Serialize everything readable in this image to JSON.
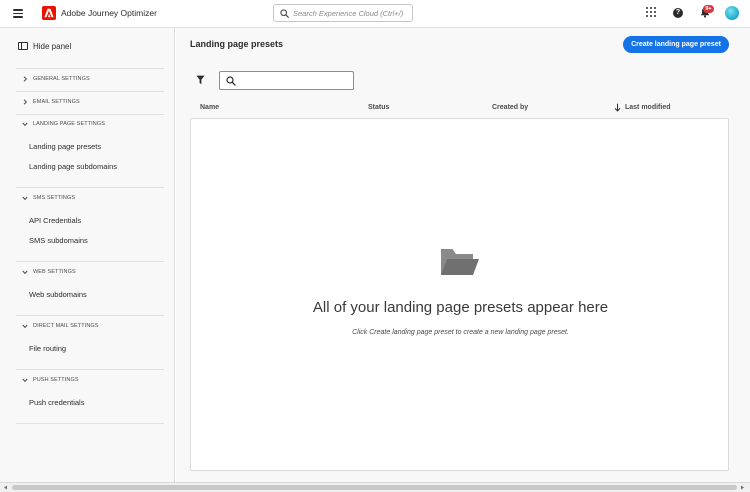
{
  "header": {
    "app_title": "Adobe Journey Optimizer",
    "search_placeholder": "Search Experience Cloud (Ctrl+/)",
    "notification_badge": "9+",
    "help_glyph": "?",
    "icons": [
      "menu-icon",
      "adobe-logo-icon",
      "search-icon",
      "apps-grid-icon",
      "help-icon",
      "bell-icon",
      "avatar"
    ]
  },
  "sidebar": {
    "hide_panel_label": "Hide panel",
    "sections": [
      {
        "label": "GENERAL SETTINGS",
        "expanded": false,
        "items": []
      },
      {
        "label": "EMAIL SETTINGS",
        "expanded": false,
        "items": []
      },
      {
        "label": "LANDING PAGE SETTINGS",
        "expanded": true,
        "items": [
          "Landing page presets",
          "Landing page subdomains"
        ]
      },
      {
        "label": "SMS SETTINGS",
        "expanded": true,
        "items": [
          "API Credentials",
          "SMS subdomains"
        ]
      },
      {
        "label": "WEB SETTINGS",
        "expanded": true,
        "items": [
          "Web subdomains"
        ]
      },
      {
        "label": "DIRECT MAIL SETTINGS",
        "expanded": true,
        "items": [
          "File routing"
        ]
      },
      {
        "label": "PUSH SETTINGS",
        "expanded": true,
        "items": [
          "Push credentials"
        ]
      }
    ]
  },
  "main": {
    "title": "Landing page presets",
    "create_button_label": "Create landing page preset",
    "search_value": "",
    "columns": [
      "Name",
      "Status",
      "Created by",
      "Last modified"
    ],
    "sort_column": "Last modified",
    "sort_direction": "descending",
    "empty_state": {
      "title": "All of your landing page presets appear here",
      "description": "Click Create landing page preset to create a new landing page preset."
    }
  },
  "colors": {
    "accent": "#1473e6",
    "adobe_red": "#eb1000",
    "badge": "#d7373f"
  }
}
